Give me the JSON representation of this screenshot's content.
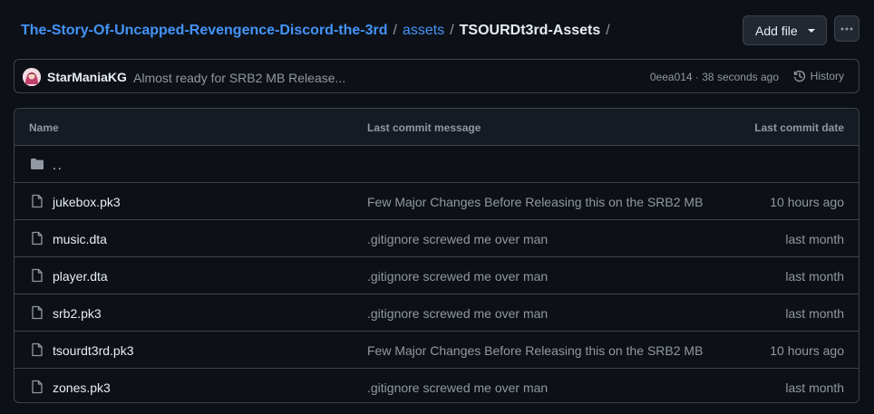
{
  "breadcrumb": {
    "repo": "The-Story-Of-Uncapped-Revengence-Discord-the-3rd",
    "folder": "assets",
    "current": "TSOURDt3rd-Assets",
    "sep": "/"
  },
  "toolbar": {
    "add_file_label": "Add file",
    "more_icon": "kebab-horizontal-icon"
  },
  "commit": {
    "author": "StarManiaKG",
    "message": "Almost ready for SRB2 MB Release...",
    "meta": "0eea014 · 38 seconds ago",
    "history_label": "History"
  },
  "table": {
    "headers": {
      "name": "Name",
      "message": "Last commit message",
      "date": "Last commit date"
    },
    "parent_label": "..",
    "rows": [
      {
        "name": "jukebox.pk3",
        "message": "Few Major Changes Before Releasing this on the SRB2 MB",
        "date": "10 hours ago"
      },
      {
        "name": "music.dta",
        "message": ".gitignore screwed me over man",
        "date": "last month"
      },
      {
        "name": "player.dta",
        "message": ".gitignore screwed me over man",
        "date": "last month"
      },
      {
        "name": "srb2.pk3",
        "message": ".gitignore screwed me over man",
        "date": "last month"
      },
      {
        "name": "tsourdt3rd.pk3",
        "message": "Few Major Changes Before Releasing this on the SRB2 MB",
        "date": "10 hours ago"
      },
      {
        "name": "zones.pk3",
        "message": ".gitignore screwed me over man",
        "date": "last month"
      }
    ]
  },
  "colors": {
    "background": "#0d1117",
    "link": "#4493f8",
    "border": "#3d444d",
    "muted": "#9198a1"
  }
}
